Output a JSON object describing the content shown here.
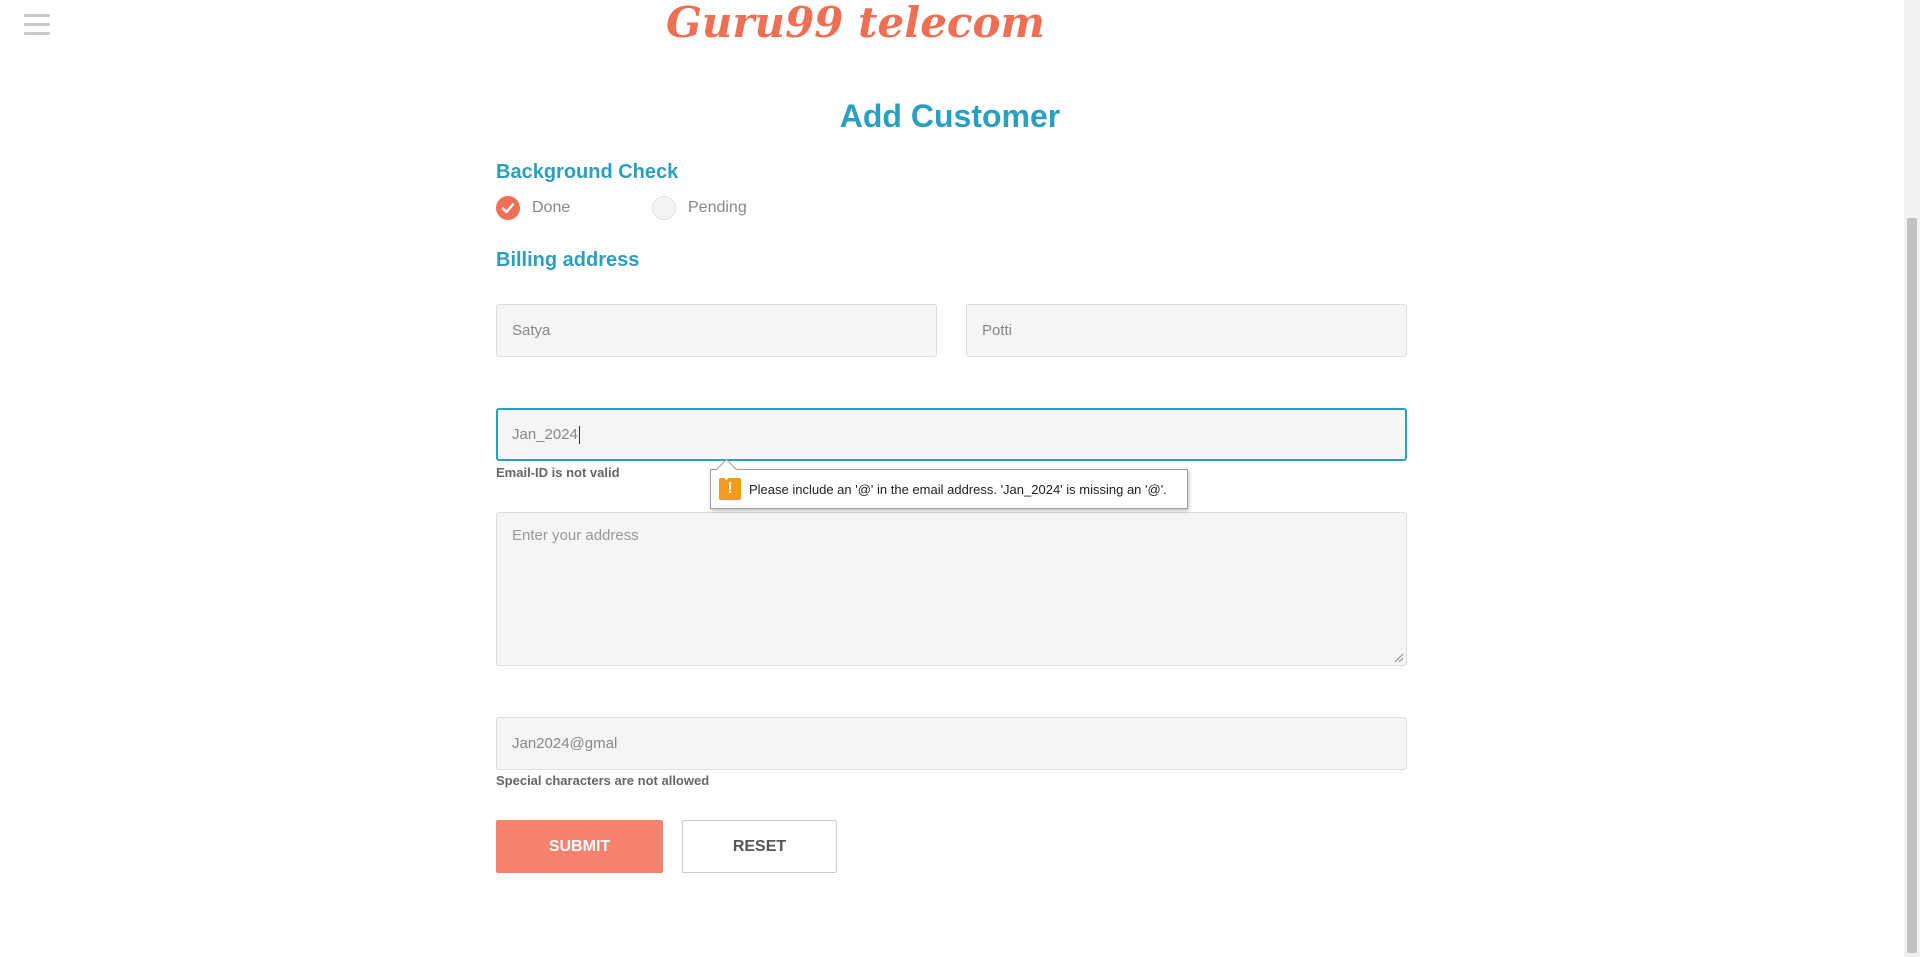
{
  "header": {
    "logo_text": "Guru99 telecom",
    "menu_icon": "hamburger-menu-icon"
  },
  "page": {
    "title": "Add Customer"
  },
  "background_check": {
    "heading": "Background Check",
    "options": [
      {
        "label": "Done",
        "selected": true
      },
      {
        "label": "Pending",
        "selected": false
      }
    ]
  },
  "billing": {
    "heading": "Billing address",
    "first_name_value": "Satya",
    "last_name_value": "Potti",
    "email_value": "Jan_2024",
    "email_error": "Email-ID is not valid",
    "address_placeholder": "Enter your address",
    "phone_value": "Jan2024@gmal",
    "phone_error": "Special characters are not allowed"
  },
  "tooltip": {
    "icon": "warning-icon",
    "message": "Please include an '@' in the email address. 'Jan_2024' is missing an '@'."
  },
  "buttons": {
    "submit_label": "SUBMIT",
    "reset_label": "RESET"
  },
  "colors": {
    "accent": "#2c9ec0",
    "brand": "#ef6f55",
    "submit": "#f5826d",
    "warning": "#f39a1f"
  }
}
